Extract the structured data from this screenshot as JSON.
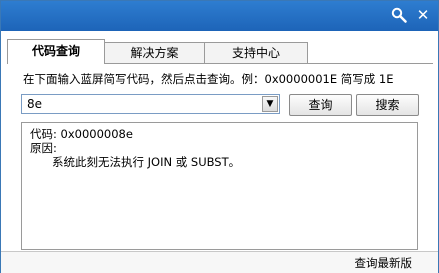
{
  "titlebar": {
    "search_icon": "magnifier-icon",
    "close_icon": "close-icon",
    "close_glyph": "✕",
    "color": "#1d64b8"
  },
  "tabs": [
    {
      "label": "代码查询",
      "active": true
    },
    {
      "label": "解决方案",
      "active": false
    },
    {
      "label": "支持中心",
      "active": false
    }
  ],
  "main": {
    "instruction": "在下面输入蓝屏简写代码，然后点击查询。例：0x0000001E 简写成 1E",
    "code_input_value": "8e",
    "dropdown_glyph": "▼",
    "query_button": "查询",
    "search_button": "搜索"
  },
  "result": {
    "code_line": "代码: 0x0000008e",
    "reason_label": "原因:",
    "reason_text": "系统此刻无法执行 JOIN 或 SUBST。"
  },
  "status": {
    "update_link": "查询最新版"
  }
}
